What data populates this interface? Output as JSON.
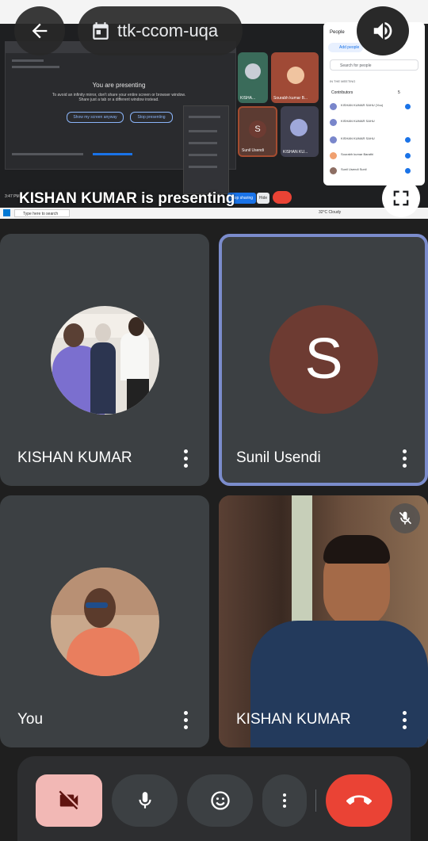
{
  "header": {
    "meeting_code": "ttk-ccom-uqa",
    "back_icon": "arrow-back-icon",
    "calendar_icon": "calendar-icon",
    "speaker_icon": "speaker-icon",
    "fullscreen_icon": "fullscreen-icon"
  },
  "presentation": {
    "presenting_label": "KISHAN KUMAR is presenting",
    "inner_title": "You are presenting",
    "inner_subtitle": "To avoid an infinity mirror, don't share your entire screen or browser window. Share just a tab or a different window instead.",
    "show_anyway_label": "Show my screen anyway",
    "stop_presenting_label": "Stop presenting",
    "clock": "3:47 PM",
    "stop_sharing_label": "Stop sharing",
    "hide_label": "Hide",
    "taskbar_search": "Type here to search",
    "taskbar_weather": "32°C  Cloudy",
    "thumbnails": [
      "KISHA...",
      "Sourabh kumar B...",
      "Sunil Usendi",
      "KISHAN KU..."
    ],
    "people_panel": {
      "title": "People",
      "add_people": "Add people",
      "search_placeholder": "Search for people",
      "section": "IN THE MEETING",
      "contributors_label": "Contributors",
      "contributors_count": "5",
      "rows": [
        {
          "name": "KISHAN KUMAR SAHU (You)",
          "sub": "Meeting host"
        },
        {
          "name": "KISHAN KUMAR SAHU",
          "sub": "Your presentation"
        },
        {
          "name": "KISHAN KUMAR SAHU",
          "sub": "Meeting host"
        },
        {
          "name": "Sourabh kumar Barathi",
          "sub": ""
        },
        {
          "name": "Sunil Usendi Sunil",
          "sub": ""
        }
      ]
    }
  },
  "tiles": [
    {
      "name": "KISHAN KUMAR",
      "type": "photo-avatar",
      "highlighted": false
    },
    {
      "name": "Sunil Usendi",
      "type": "letter-avatar",
      "letter": "S",
      "avatar_color": "#6d3b32",
      "highlighted": true
    },
    {
      "name": "You",
      "type": "photo-avatar",
      "highlighted": false
    },
    {
      "name": "KISHAN KUMAR",
      "type": "video",
      "muted": true,
      "highlighted": false
    }
  ],
  "controls": {
    "camera": "camera-off-icon",
    "mic": "mic-icon",
    "reactions": "emoji-icon",
    "more": "more-vert-icon",
    "leave": "call-end-icon"
  },
  "colors": {
    "background": "#1f1f1f",
    "tile": "#3c4043",
    "highlight_border": "#7b8ccc",
    "leave_red": "#ea4335",
    "camera_off_bg": "#f2b8b5"
  }
}
